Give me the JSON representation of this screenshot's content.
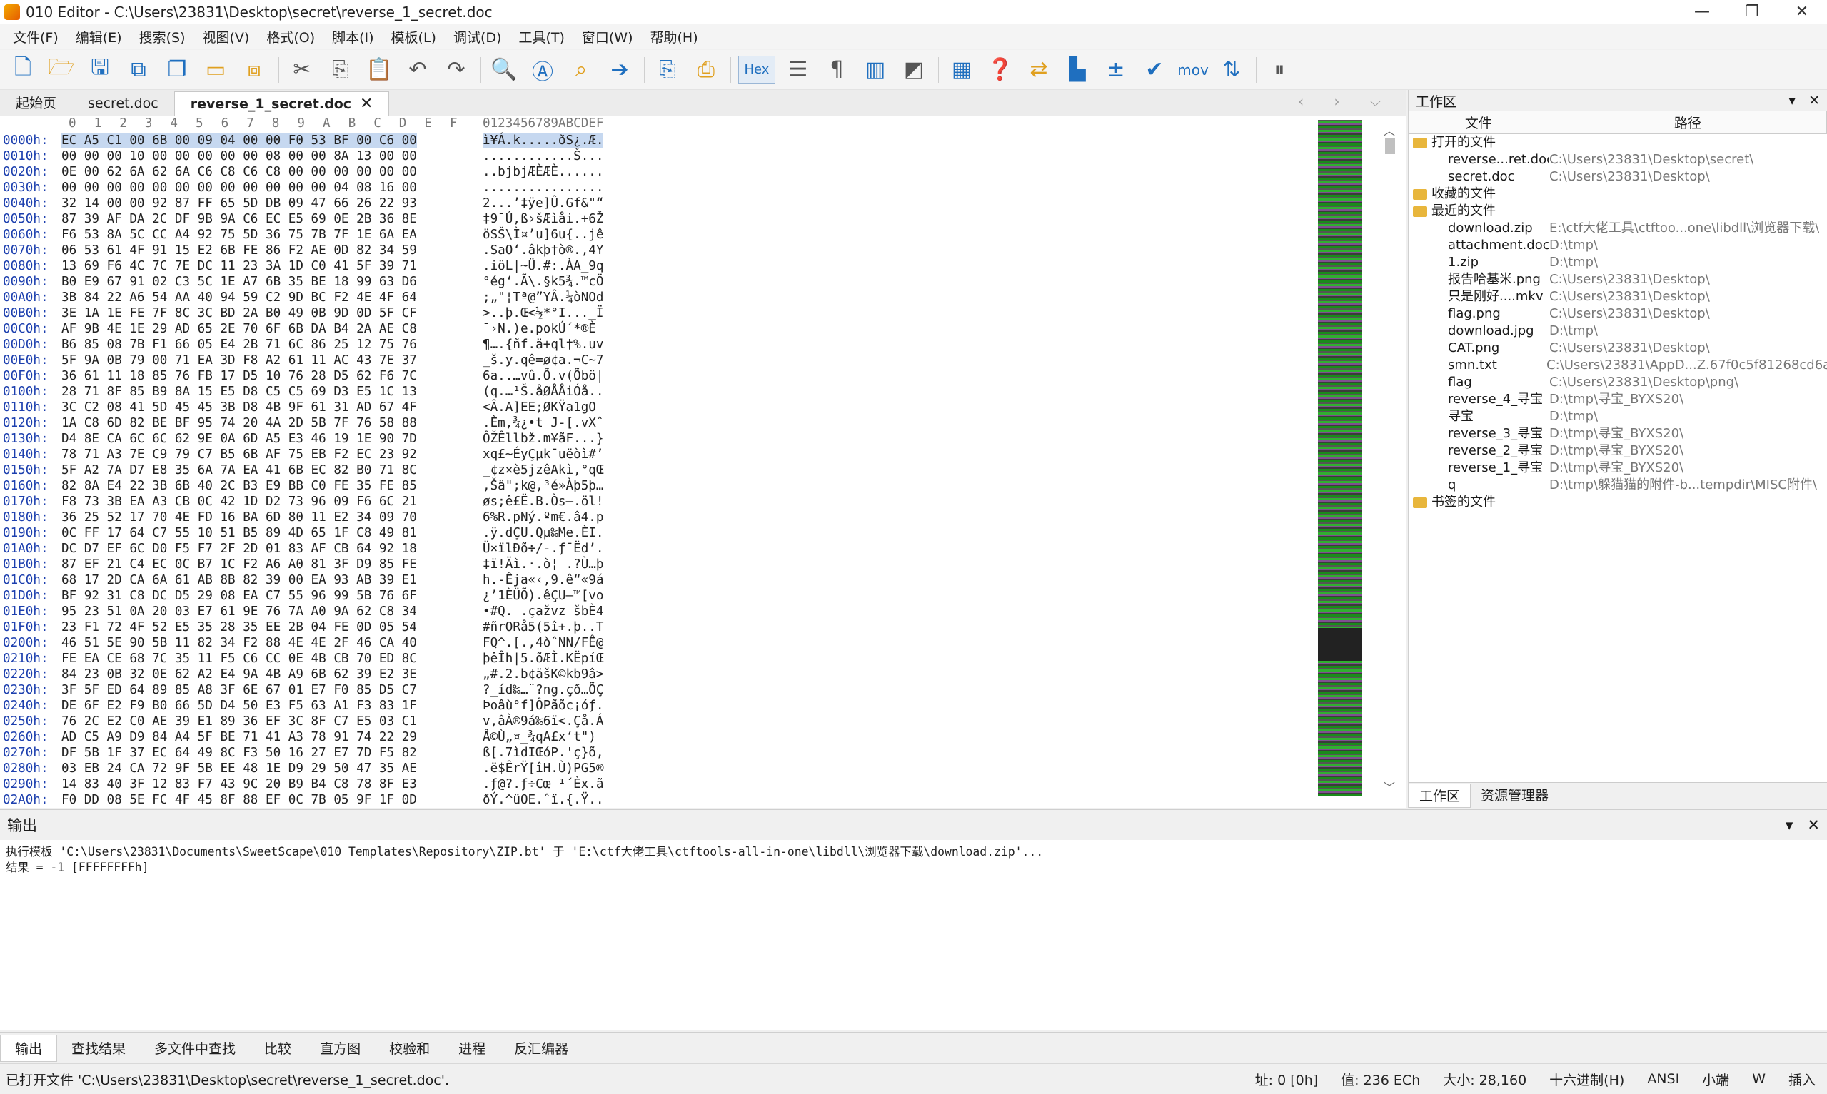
{
  "window": {
    "title": "010 Editor - C:\\Users\\23831\\Desktop\\secret\\reverse_1_secret.doc",
    "min": "—",
    "max": "❐",
    "close": "✕"
  },
  "menu": [
    "文件(F)",
    "编辑(E)",
    "搜索(S)",
    "视图(V)",
    "格式(O)",
    "脚本(I)",
    "模板(L)",
    "调试(D)",
    "工具(T)",
    "窗口(W)",
    "帮助(H)"
  ],
  "toolbar": {
    "hex_label": "Hex",
    "mov_label": "mov"
  },
  "tabs": {
    "items": [
      "起始页",
      "secret.doc",
      "reverse_1_secret.doc"
    ],
    "close": "✕",
    "nav": "‹ › ⌵"
  },
  "hex": {
    "header_cols": [
      "0",
      "1",
      "2",
      "3",
      "4",
      "5",
      "6",
      "7",
      "8",
      "9",
      "A",
      "B",
      "C",
      "D",
      "E",
      "F"
    ],
    "header_ascii": "0123456789ABCDEF",
    "rows": [
      {
        "a": "0000h:",
        "b": "EC A5 C1 00 6B 00 09 04 00 00 F0 53 BF 00 C6 00",
        "s": "ì¥Á.k.....ðS¿.Æ."
      },
      {
        "a": "0010h:",
        "b": "00 00 00 10 00 00 00 00 00 08 00 00 8A 13 00 00",
        "s": "............Š..."
      },
      {
        "a": "0020h:",
        "b": "0E 00 62 6A 62 6A C6 C8 C6 C8 00 00 00 00 00 00",
        "s": "..bjbjÆÈÆÈ......"
      },
      {
        "a": "0030h:",
        "b": "00 00 00 00 00 00 00 00 00 00 00 00 04 08 16 00",
        "s": "................"
      },
      {
        "a": "0040h:",
        "b": "32 14 00 00 92 87 FF 65 5D DB 09 47 66 26 22 93",
        "s": "2...’‡ÿe]Û.Gf&\"“"
      },
      {
        "a": "0050h:",
        "b": "87 39 AF DA 2C DF 9B 9A C6 EC E5 69 0E 2B 36 8E",
        "s": "‡9¯Ú,ß›šÆìåi.+6Ž"
      },
      {
        "a": "0060h:",
        "b": "F6 53 8A 5C CC A4 92 75 5D 36 75 7B 7F 1E 6A EA",
        "s": "öSŠ\\Ì¤’u]6u{..jê"
      },
      {
        "a": "0070h:",
        "b": "06 53 61 4F 91 15 E2 6B FE 86 F2 AE 0D 82 34 59",
        "s": ".SaO‘.âkþ†ò®.‚4Y"
      },
      {
        "a": "0080h:",
        "b": "13 69 F6 4C 7C 7E DC 11 23 3A 1D C0 41 5F 39 71",
        "s": ".iöL|~Ü.#:.ÀA_9q"
      },
      {
        "a": "0090h:",
        "b": "B0 E9 67 91 02 C3 5C 1E A7 6B 35 BE 18 99 63 D6",
        "s": "°ég‘.Ã\\.§k5¾.™cÖ"
      },
      {
        "a": "00A0h:",
        "b": "3B 84 22 A6 54 AA 40 94 59 C2 9D BC F2 4E 4F 64",
        "s": ";„\"¦Tª@”YÂ.¼òNOd"
      },
      {
        "a": "00B0h:",
        "b": "3E 1A 1E FE 7F 8C 3C BD 2A B0 49 0B 9D 0D 5F CF",
        "s": ">..þ.Œ<½*°I..._Ï"
      },
      {
        "a": "00C0h:",
        "b": "AF 9B 4E 1E 29 AD 65 2E 70 6F 6B DA B4 2A AE C8",
        "s": "¯›N.)­e.pokÚ´*®È"
      },
      {
        "a": "00D0h:",
        "b": "B6 85 08 7B F1 66 05 E4 2B 71 6C 86 25 12 75 76",
        "s": "¶….{ñf.ä+ql†%.uv"
      },
      {
        "a": "00E0h:",
        "b": "5F 9A 0B 79 00 71 EA 3D F8 A2 61 11 AC 43 7E 37",
        "s": "_š.y.qê=ø¢a.¬C~7"
      },
      {
        "a": "00F0h:",
        "b": "36 61 11 18 85 76 FB 17 D5 10 76 28 D5 62 F6 7C",
        "s": "6a..…vû.Õ.v(Õbö|"
      },
      {
        "a": "0100h:",
        "b": "28 71 8F 85 B9 8A 15 E5 D8 C5 C5 69 D3 E5 1C 13",
        "s": "(q.…¹Š.åØÅÅiÓå.."
      },
      {
        "a": "0110h:",
        "b": "3C C2 08 41 5D 45 45 3B D8 4B 9F 61 31 AD 67 4F",
        "s": "<Â.A]EE;ØKŸa1­gO"
      },
      {
        "a": "0120h:",
        "b": "1A C8 6D 82 BE BF 95 74 20 4A 2D 5B 7F 76 58 88",
        "s": ".Èm‚¾¿•t J-[.vXˆ"
      },
      {
        "a": "0130h:",
        "b": "D4 8E CA 6C 6C 62 9E 0A 6D A5 E3 46 19 1E 90 7D",
        "s": "ÔŽÊllbž.m¥ãF...}"
      },
      {
        "a": "0140h:",
        "b": "78 71 A3 7E C9 79 C7 B5 6B AF 75 EB F2 EC 23 92",
        "s": "xq£~ÉyÇµk¯uëòì#’"
      },
      {
        "a": "0150h:",
        "b": "5F A2 7A D7 E8 35 6A 7A EA 41 6B EC 82 B0 71 8C",
        "s": "_¢z×è5jzêAkì‚°qŒ"
      },
      {
        "a": "0160h:",
        "b": "82 8A E4 22 3B 6B 40 2C B3 E9 BB C0 FE 35 FE 85",
        "s": "‚Šä\";k@,³é»Àþ5þ…"
      },
      {
        "a": "0170h:",
        "b": "F8 73 3B EA A3 CB 0C 42 1D D2 73 96 09 F6 6C 21",
        "s": "øs;ê£Ë.B.Òs–.öl!"
      },
      {
        "a": "0180h:",
        "b": "36 25 52 17 70 4E FD 16 BA 6D 80 11 E2 34 09 70",
        "s": "6%R.pNý.ºm€.â4.p"
      },
      {
        "a": "0190h:",
        "b": "0C FF 17 64 C7 55 10 51 B5 89 4D 65 1F C8 49 81",
        "s": ".ÿ.dÇU.Qµ‰Me.ÈI."
      },
      {
        "a": "01A0h:",
        "b": "DC D7 EF 6C D0 F5 F7 2F 2D 01 83 AF CB 64 92 18",
        "s": "Ü×ïlÐõ÷/-.ƒ¯Ëd’."
      },
      {
        "a": "01B0h:",
        "b": "87 EF 21 C4 EC 0C B7 1C F2 A6 A0 81 3F D9 85 FE",
        "s": "‡ï!Äì.·.ò¦ .?Ù…þ"
      },
      {
        "a": "01C0h:",
        "b": "68 17 2D CA 6A 61 AB 8B 82 39 00 EA 93 AB 39 E1",
        "s": "h.-Êja«‹‚9.ê“«9á"
      },
      {
        "a": "01D0h:",
        "b": "BF 92 31 C8 DC D5 29 08 EA C7 55 96 99 5B 76 6F",
        "s": "¿’1ÈÜÕ).êÇU–™[vo"
      },
      {
        "a": "01E0h:",
        "b": "95 23 51 0A 20 03 E7 61 9E 76 7A A0 9A 62 C8 34",
        "s": "•#Q. .çažvz šbÈ4"
      },
      {
        "a": "01F0h:",
        "b": "23 F1 72 4F 52 E5 35 28 35 EE 2B 04 FE 0D 05 54",
        "s": "#ñrORå5(5î+.þ..T"
      },
      {
        "a": "0200h:",
        "b": "46 51 5E 90 5B 11 82 34 F2 88 4E 4E 2F 46 CA 40",
        "s": "FQ^.[.‚4òˆNN/FÊ@"
      },
      {
        "a": "0210h:",
        "b": "FE EA CE 68 7C 35 11 F5 C6 CC 0E 4B CB 70 ED 8C",
        "s": "þêÎh|5.õÆÌ.KËpíŒ"
      },
      {
        "a": "0220h:",
        "b": "84 23 0B 32 0E 62 A2 E4 9A 4B A9 6B 62 39 E2 3E",
        "s": "„#.2.b¢äšK©kb9â>"
      },
      {
        "a": "0230h:",
        "b": "3F 5F ED 64 89 85 A8 3F 6E 67 01 E7 F0 85 D5 C7",
        "s": "?_íd‰…¨?ng.çð…ÕÇ"
      },
      {
        "a": "0240h:",
        "b": "DE 6F E2 F9 B0 66 5D D4 50 E3 F5 63 A1 F3 83 1F",
        "s": "Þoâù°f]ÔPãõc¡óƒ."
      },
      {
        "a": "0250h:",
        "b": "76 2C E2 C0 AE 39 E1 89 36 EF 3C 8F C7 E5 03 C1",
        "s": "v,âÀ®9á‰6ï<.Çå.Á"
      },
      {
        "a": "0260h:",
        "b": "AD C5 A9 D9 84 A4 5F BE 71 41 A3 78 91 74 22 29",
        "s": "­Å©Ù„¤_¾qA£x‘t\")"
      },
      {
        "a": "0270h:",
        "b": "DF 5B 1F 37 EC 64 49 8C F3 50 16 27 E7 7D F5 82",
        "s": "ß[.7ìdIŒóP.'ç}õ‚"
      },
      {
        "a": "0280h:",
        "b": "03 EB 24 CA 72 9F 5B EE 48 1E D9 29 50 47 35 AE",
        "s": ".ë$ÊrŸ[îH.Ù)PG5®"
      },
      {
        "a": "0290h:",
        "b": "14 83 40 3F 12 83 F7 43 9C 20 B9 B4 C8 78 8F E3",
        "s": ".ƒ@?.ƒ÷Cœ ¹´Èx.ã"
      },
      {
        "a": "02A0h:",
        "b": "F0 DD 08 5E FC 4F 45 8F 88 EF 0C 7B 05 9F 1F 0D",
        "s": "ðÝ.^üOE.ˆï.{.Ÿ.."
      }
    ]
  },
  "workspace": {
    "title": "工作区",
    "col_file": "文件",
    "col_path": "路径",
    "groups": {
      "open": "打开的文件",
      "fav": "收藏的文件",
      "recent": "最近的文件",
      "bookmarks": "书签的文件"
    },
    "open_files": [
      {
        "n": "reverse...ret.doc",
        "p": "C:\\Users\\23831\\Desktop\\secret\\"
      },
      {
        "n": "secret.doc",
        "p": "C:\\Users\\23831\\Desktop\\"
      }
    ],
    "recent_files": [
      {
        "n": "download.zip",
        "p": "E:\\ctf大佬工具\\ctftoo...one\\libdll\\浏览器下载\\"
      },
      {
        "n": "attachment.doc",
        "p": "D:\\tmp\\"
      },
      {
        "n": "1.zip",
        "p": "D:\\tmp\\"
      },
      {
        "n": "报告哈基米.png",
        "p": "C:\\Users\\23831\\Desktop\\"
      },
      {
        "n": "只是刚好....mkv",
        "p": "C:\\Users\\23831\\Desktop\\"
      },
      {
        "n": "flag.png",
        "p": "C:\\Users\\23831\\Desktop\\"
      },
      {
        "n": "download.jpg",
        "p": "D:\\tmp\\"
      },
      {
        "n": "CAT.png",
        "p": "C:\\Users\\23831\\Desktop\\"
      },
      {
        "n": "smn.txt",
        "p": "C:\\Users\\23831\\AppD...Z.67f0c5f81268cd6a\\"
      },
      {
        "n": "flag",
        "p": "C:\\Users\\23831\\Desktop\\png\\"
      },
      {
        "n": "reverse_4_寻宝",
        "p": "D:\\tmp\\寻宝_BYXS20\\"
      },
      {
        "n": "寻宝",
        "p": "D:\\tmp\\"
      },
      {
        "n": "reverse_3_寻宝",
        "p": "D:\\tmp\\寻宝_BYXS20\\"
      },
      {
        "n": "reverse_2_寻宝",
        "p": "D:\\tmp\\寻宝_BYXS20\\"
      },
      {
        "n": "reverse_1_寻宝",
        "p": "D:\\tmp\\寻宝_BYXS20\\"
      },
      {
        "n": "q",
        "p": "D:\\tmp\\躲猫猫的附件-b...tempdir\\MISC附件\\"
      }
    ],
    "tab_workspace": "工作区",
    "tab_explorer": "资源管理器"
  },
  "output": {
    "title": "输出",
    "line1": "执行模板 'C:\\Users\\23831\\Documents\\SweetScape\\010 Templates\\Repository\\ZIP.bt' 于 'E:\\ctf大佬工具\\ctftools-all-in-one\\libdll\\浏览器下载\\download.zip'...",
    "line2": "结果 = -1 [FFFFFFFFh]"
  },
  "bottom_tabs": [
    "输出",
    "查找结果",
    "多文件中查找",
    "比较",
    "直方图",
    "校验和",
    "进程",
    "反汇编器"
  ],
  "status": {
    "message": "已打开文件 'C:\\Users\\23831\\Desktop\\secret\\reverse_1_secret.doc'.",
    "address": "址: 0 [0h]",
    "value": "值: 236 ECh",
    "size": "大小: 28,160",
    "mode": "十六进制(H)",
    "encoding": "ANSI",
    "endian": "小端",
    "w": "W",
    "insert": "插入"
  }
}
